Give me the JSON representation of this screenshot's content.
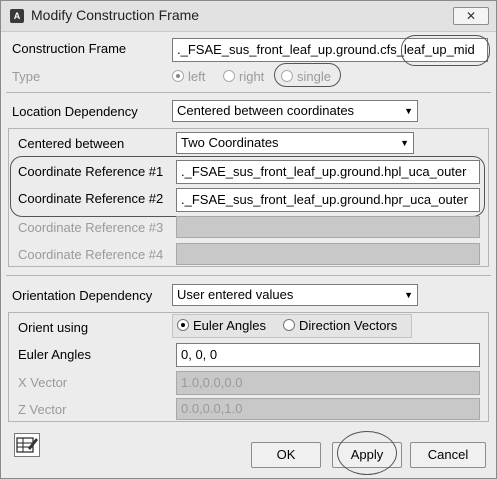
{
  "window": {
    "icon_letter": "A",
    "title": "Modify Construction Frame",
    "close_glyph": "✕"
  },
  "construction_frame": {
    "label": "Construction Frame",
    "value": "._FSAE_sus_front_leaf_up.ground.cfs_leaf_up_mid"
  },
  "type": {
    "label": "Type",
    "options": [
      "left",
      "right",
      "single"
    ],
    "selected": "left"
  },
  "location": {
    "label": "Location Dependency",
    "value": "Centered between coordinates",
    "centered_between_label": "Centered between",
    "centered_between_value": "Two Coordinates",
    "refs": [
      {
        "label": "Coordinate Reference #1",
        "value": "._FSAE_sus_front_leaf_up.ground.hpl_uca_outer"
      },
      {
        "label": "Coordinate Reference #2",
        "value": "._FSAE_sus_front_leaf_up.ground.hpr_uca_outer"
      },
      {
        "label": "Coordinate Reference #3",
        "value": ""
      },
      {
        "label": "Coordinate Reference #4",
        "value": ""
      }
    ]
  },
  "orientation": {
    "label": "Orientation Dependency",
    "value": "User entered values",
    "orient_using_label": "Orient using",
    "orient_options": [
      "Euler Angles",
      "Direction Vectors"
    ],
    "orient_selected": "Euler Angles",
    "euler_label": "Euler Angles",
    "euler_value": "0, 0, 0",
    "x_vector_label": "X Vector",
    "x_vector_value": "1.0,0.0,0.0",
    "z_vector_label": "Z Vector",
    "z_vector_value": "0.0,0.0,1.0"
  },
  "buttons": {
    "ok": "OK",
    "apply": "Apply",
    "cancel": "Cancel"
  },
  "icons": {
    "dropdown_arrow": "▼",
    "bottom_tool": "edit-table-icon"
  }
}
